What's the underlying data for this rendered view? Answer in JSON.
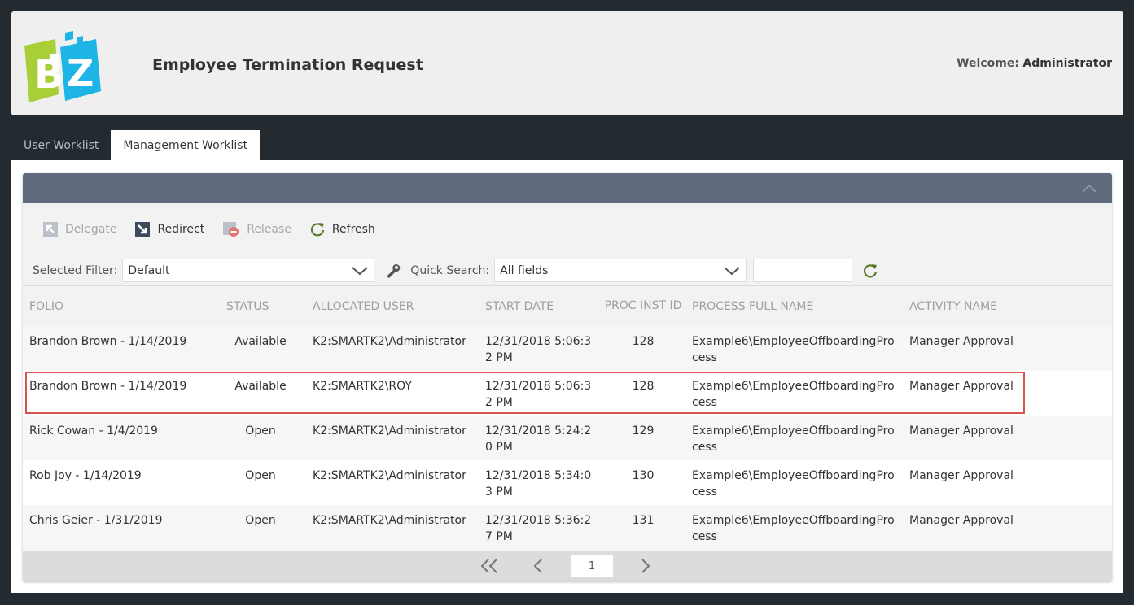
{
  "header": {
    "title": "Employee Termination Request",
    "welcome_label": "Welcome:",
    "user_name": "Administrator"
  },
  "tabs": [
    {
      "label": "User Worklist",
      "active": false
    },
    {
      "label": "Management Worklist",
      "active": true
    }
  ],
  "toolbar": {
    "delegate": "Delegate",
    "redirect": "Redirect",
    "release": "Release",
    "refresh": "Refresh"
  },
  "filter": {
    "selected_filter_label": "Selected Filter:",
    "selected_filter_value": "Default",
    "quick_search_label": "Quick Search:",
    "quick_search_value": "All fields",
    "search_text": ""
  },
  "table": {
    "columns": [
      "FOLIO",
      "STATUS",
      "ALLOCATED USER",
      "START DATE",
      "PROC INST ID",
      "PROCESS FULL NAME",
      "ACTIVITY NAME"
    ],
    "rows": [
      {
        "folio": "Brandon Brown - 1/14/2019",
        "status": "Available",
        "user": "K2:SMARTK2\\Administrator",
        "start": "12/31/2018 5:06:32 PM",
        "id": "128",
        "process": "Example6\\EmployeeOffboardingProcess",
        "activity": "Manager Approval"
      },
      {
        "folio": "Brandon Brown - 1/14/2019",
        "status": "Available",
        "user": "K2:SMARTK2\\ROY",
        "start": "12/31/2018 5:06:32 PM",
        "id": "128",
        "process": "Example6\\EmployeeOffboardingProcess",
        "activity": "Manager Approval"
      },
      {
        "folio": "Rick Cowan - 1/4/2019",
        "status": "Open",
        "user": "K2:SMARTK2\\Administrator",
        "start": "12/31/2018 5:24:20 PM",
        "id": "129",
        "process": "Example6\\EmployeeOffboardingProcess",
        "activity": "Manager Approval"
      },
      {
        "folio": "Rob Joy - 1/14/2019",
        "status": "Open",
        "user": "K2:SMARTK2\\Administrator",
        "start": "12/31/2018 5:34:03 PM",
        "id": "130",
        "process": "Example6\\EmployeeOffboardingProcess",
        "activity": "Manager Approval"
      },
      {
        "folio": "Chris Geier - 1/31/2019",
        "status": "Open",
        "user": "K2:SMARTK2\\Administrator",
        "start": "12/31/2018 5:36:27 PM",
        "id": "131",
        "process": "Example6\\EmployeeOffboardingProcess",
        "activity": "Manager Approval"
      }
    ]
  },
  "pager": {
    "page": "1"
  },
  "colors": {
    "panel_header": "#5f6b7d",
    "highlight": "#d9534f",
    "background": "#232a30"
  }
}
